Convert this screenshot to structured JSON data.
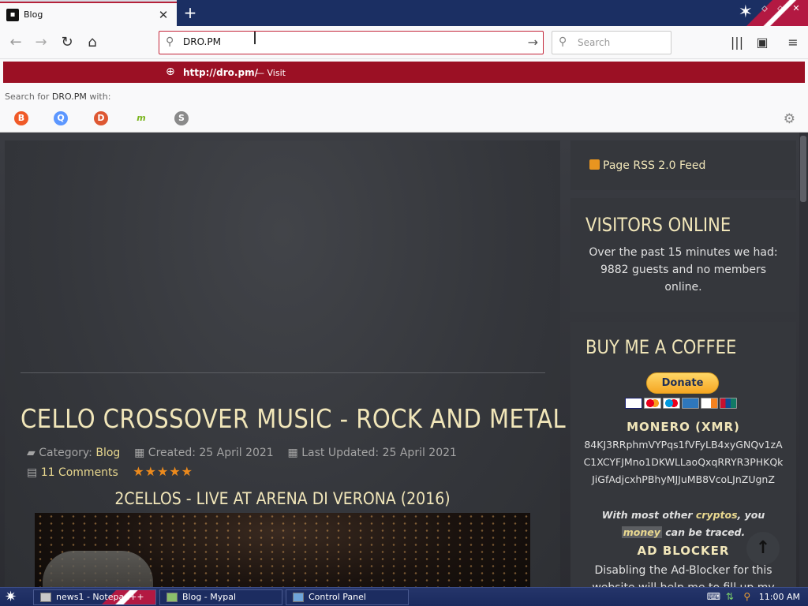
{
  "browser": {
    "tab": {
      "title": "Blog",
      "close_glyph": "✕"
    },
    "new_tab_glyph": "+",
    "nav": {
      "back": "←",
      "forward": "→",
      "reload": "↻",
      "home": "⌂"
    },
    "url": {
      "value": "DRO.PM",
      "go": "→"
    },
    "search": {
      "placeholder": "Search"
    },
    "toolbar": {
      "library": "|||",
      "sidebar": "▣",
      "menu": "≡"
    },
    "window_controls": [
      "⬦",
      "⬦",
      "✕"
    ]
  },
  "url_dropdown": {
    "url": "http://dro.pm/",
    "separator": "—",
    "action": "Visit",
    "search_with_prefix": "Search for ",
    "search_with_term": "DRO.PM",
    "search_with_suffix": " with:",
    "engines": [
      {
        "name": "brave",
        "glyph": "B",
        "color": "#f05a28"
      },
      {
        "name": "qwant",
        "glyph": "Q",
        "color": "#5c97ff"
      },
      {
        "name": "duckduckgo",
        "glyph": "D",
        "color": "#de5833"
      },
      {
        "name": "mojeek",
        "glyph": "m",
        "color": "#7ab51d"
      },
      {
        "name": "searx",
        "glyph": "S",
        "color": "#8a8a8a"
      }
    ]
  },
  "page": {
    "article": {
      "title": "CELLO CROSSOVER MUSIC - ROCK AND METAL",
      "category_label": "Category:",
      "category": "Blog",
      "created": "Created: 25 April 2021",
      "updated": "Last Updated: 25 April 2021",
      "comments": "11 Comments",
      "rating_stars": "★★★★★",
      "video_title": "2CELLOS - LIVE AT ARENA DI VERONA (2016)"
    },
    "sidebar": {
      "rss": "Page RSS 2.0 Feed",
      "visitors_title": "VISITORS ONLINE",
      "visitors_text": "Over the past 15 minutes we had: 9882 guests and no members online.",
      "coffee_title": "BUY ME A COFFEE",
      "donate": "Donate",
      "monero_title": "MONERO (XMR)",
      "monero_address": "84KJ3RRphmVYPqs1fVFyLB4xyGNQv1zAC1XCYFJMno1DKWLLaoQxqRRYR3PHKQkJiGfAdjcxhPBhyMJJuMB8VcoLJnZUgnZ",
      "note_1": "With most other ",
      "note_cryptos": "cryptos",
      "note_2": ", you ",
      "note_money": "money",
      "note_3": " can be traced.",
      "adblock_title": "AD BLOCKER",
      "adblock_text": "Disabling the Ad-Blocker for this website will help me to fill up my"
    },
    "to_top": "↑"
  },
  "taskbar": {
    "start_glyph": "✷",
    "tasks": [
      "news1 - Notepad++",
      "Blog - Mypal",
      "Control Panel"
    ],
    "clock": "11:00 AM"
  }
}
